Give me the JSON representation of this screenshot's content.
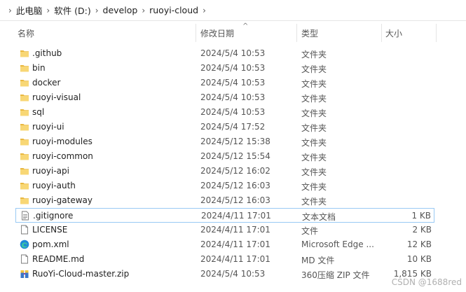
{
  "breadcrumb": [
    "此电脑",
    "软件 (D:)",
    "develop",
    "ruoyi-cloud"
  ],
  "columns": {
    "name": "名称",
    "date": "修改日期",
    "type": "类型",
    "size": "大小"
  },
  "files": [
    {
      "name": ".github",
      "date": "2024/5/4 10:53",
      "type": "文件夹",
      "size": "",
      "icon": "folder-icon"
    },
    {
      "name": "bin",
      "date": "2024/5/4 10:53",
      "type": "文件夹",
      "size": "",
      "icon": "folder-icon"
    },
    {
      "name": "docker",
      "date": "2024/5/4 10:53",
      "type": "文件夹",
      "size": "",
      "icon": "folder-icon"
    },
    {
      "name": "ruoyi-visual",
      "date": "2024/5/4 10:53",
      "type": "文件夹",
      "size": "",
      "icon": "folder-icon"
    },
    {
      "name": "sql",
      "date": "2024/5/4 10:53",
      "type": "文件夹",
      "size": "",
      "icon": "folder-icon"
    },
    {
      "name": "ruoyi-ui",
      "date": "2024/5/4 17:52",
      "type": "文件夹",
      "size": "",
      "icon": "folder-icon"
    },
    {
      "name": "ruoyi-modules",
      "date": "2024/5/12 15:38",
      "type": "文件夹",
      "size": "",
      "icon": "folder-icon"
    },
    {
      "name": "ruoyi-common",
      "date": "2024/5/12 15:54",
      "type": "文件夹",
      "size": "",
      "icon": "folder-icon"
    },
    {
      "name": "ruoyi-api",
      "date": "2024/5/12 16:02",
      "type": "文件夹",
      "size": "",
      "icon": "folder-icon"
    },
    {
      "name": "ruoyi-auth",
      "date": "2024/5/12 16:03",
      "type": "文件夹",
      "size": "",
      "icon": "folder-icon"
    },
    {
      "name": "ruoyi-gateway",
      "date": "2024/5/12 16:03",
      "type": "文件夹",
      "size": "",
      "icon": "folder-icon"
    },
    {
      "name": ".gitignore",
      "date": "2024/4/11 17:01",
      "type": "文本文档",
      "size": "1 KB",
      "icon": "text-file-icon",
      "selected": true
    },
    {
      "name": "LICENSE",
      "date": "2024/4/11 17:01",
      "type": "文件",
      "size": "2 KB",
      "icon": "blank-file-icon"
    },
    {
      "name": "pom.xml",
      "date": "2024/4/11 17:01",
      "type": "Microsoft Edge ...",
      "size": "12 KB",
      "icon": "edge-icon"
    },
    {
      "name": "README.md",
      "date": "2024/4/11 17:01",
      "type": "MD 文件",
      "size": "10 KB",
      "icon": "blank-file-icon"
    },
    {
      "name": "RuoYi-Cloud-master.zip",
      "date": "2024/5/4 10:53",
      "type": "360压缩 ZIP 文件",
      "size": "1,815 KB",
      "icon": "zip-icon"
    }
  ],
  "watermark": "CSDN @1688red",
  "colors": {
    "folder": "#f8d775",
    "folder_dark": "#e9b840",
    "selection_border": "#99c9f4"
  }
}
